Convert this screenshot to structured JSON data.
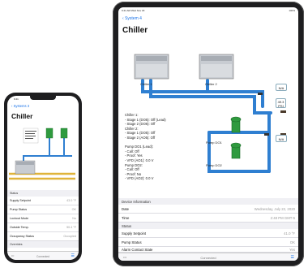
{
  "ipad": {
    "status_left": "9:41 AM  Wed Nov 18",
    "status_right": "100%",
    "back_label": "System 4",
    "title": "Chiller",
    "diagram": {
      "chiller1_label": "Chiller 1",
      "chiller2_label": "Chiller 2",
      "pump1_label": "Pump DO1",
      "pump2_label": "Pump DO2",
      "na1": "N/A",
      "na2": "N/A",
      "psi_value": "49.3",
      "psi_unit": "PSI",
      "status_text": "Chiller 1:\n- Stage 1 (DO5): Off (Lead)\n- Stage 2 (DO6): Off\nChiller 2:\n- Stage 1 (DO5): Off\n- Stage 2 (AO5): Off\n\nPump DO1 (Lead):\n- Call: Off\n- Proof: Yes\n- VFD (AO1): 0.0 V\nPump DO2:\n- Call: Off\n- Proof: No\n- VFD (AO2): 0.0 V"
    },
    "table": {
      "section_device": "Device Information",
      "date_label": "Date",
      "date_value": "Wednesday, July 22, 2020",
      "time_label": "Time",
      "time_value": "2:48 PM GMT-5",
      "section_status": "Status",
      "supply_setpoint_label": "Supply Setpoint",
      "supply_setpoint_value": "41.0 °F",
      "pump_status_label": "Pump Status",
      "pump_status_value": "OK",
      "alarm_contact_label": "Alarm Contact State",
      "alarm_contact_value": "Yes"
    },
    "tabbar": {
      "center": "Connected"
    }
  },
  "iphone": {
    "time": "9:41",
    "back_label": "Systems 3",
    "title": "Chiller",
    "table": {
      "section_status": "Status",
      "rows": [
        {
          "label": "Supply Setpoint",
          "value": "43.0 °F"
        },
        {
          "label": "Pump Status",
          "value": "OK"
        },
        {
          "label": "Lockout Mode",
          "value": "No"
        },
        {
          "label": "Outside Temp.",
          "value": "50.4 °F"
        },
        {
          "label": "Occupancy Status",
          "value": "Occupied"
        }
      ],
      "section_overrides": "Overrides"
    },
    "tabbar": {
      "center": "Connected"
    }
  },
  "colors": {
    "pipe_blue": "#2f7fd1",
    "pipe_yellow": "#e0b43a",
    "pump_green": "#2f9a3f",
    "accent": "#1a73e8"
  }
}
